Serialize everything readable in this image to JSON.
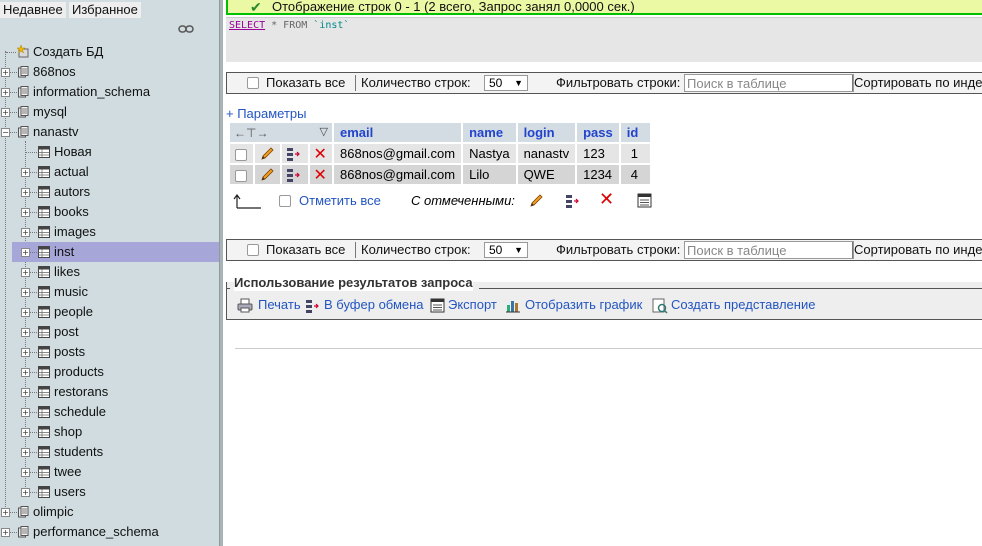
{
  "nav": {
    "tabs": {
      "recent": "Недавнее",
      "favorites": "Избранное"
    },
    "tree": {
      "create_db": "Создать БД",
      "databases_before": [
        "868nos",
        "information_schema",
        "mysql"
      ],
      "current_db": "nanastv",
      "new_table": "Новая",
      "tables": [
        "actual",
        "autors",
        "books",
        "images",
        "inst",
        "likes",
        "music",
        "people",
        "post",
        "posts",
        "products",
        "restorans",
        "schedule",
        "shop",
        "students",
        "twee",
        "users"
      ],
      "selected_table": "inst",
      "databases_after": [
        "olimpic",
        "performance_schema"
      ]
    }
  },
  "main": {
    "success_message": "Отображение строк 0 - 1 (2 всего, Запрос занял 0,0000 сек.)",
    "sql": {
      "select": "SELECT",
      "rest": " * FROM ",
      "table": "`inst`"
    },
    "navbar": {
      "show_all": "Показать все",
      "rows_label": "Количество строк:",
      "rows_value": "50",
      "filter_label": "Фильтровать строки:",
      "filter_placeholder": "Поиск в таблице",
      "sort_label": "Сортировать по инде"
    },
    "params_link": "+ Параметры",
    "table": {
      "columns": [
        "email",
        "name",
        "login",
        "pass",
        "id"
      ],
      "rows": [
        {
          "email": "868nos@gmail.com",
          "name": "Nastya",
          "login": "nanastv",
          "pass": "123",
          "id": "1"
        },
        {
          "email": "868nos@gmail.com",
          "name": "Lilo",
          "login": "QWE",
          "pass": "1234",
          "id": "4"
        }
      ]
    },
    "check_all": "Отметить все",
    "with_selected": "С отмеченными:",
    "query_results": {
      "legend": "Использование результатов запроса",
      "print": "Печать",
      "clipboard": "В буфер обмена",
      "export": "Экспорт",
      "chart": "Отобразить график",
      "create_view": "Создать представление"
    },
    "colors": {
      "success_bg": "#ebf8a4",
      "success_border": "#00c000",
      "link": "#2355c2",
      "header_bg": "#d3dce3",
      "nav_bg": "#d0dce0",
      "selected_bg": "#a6a6d8"
    }
  }
}
